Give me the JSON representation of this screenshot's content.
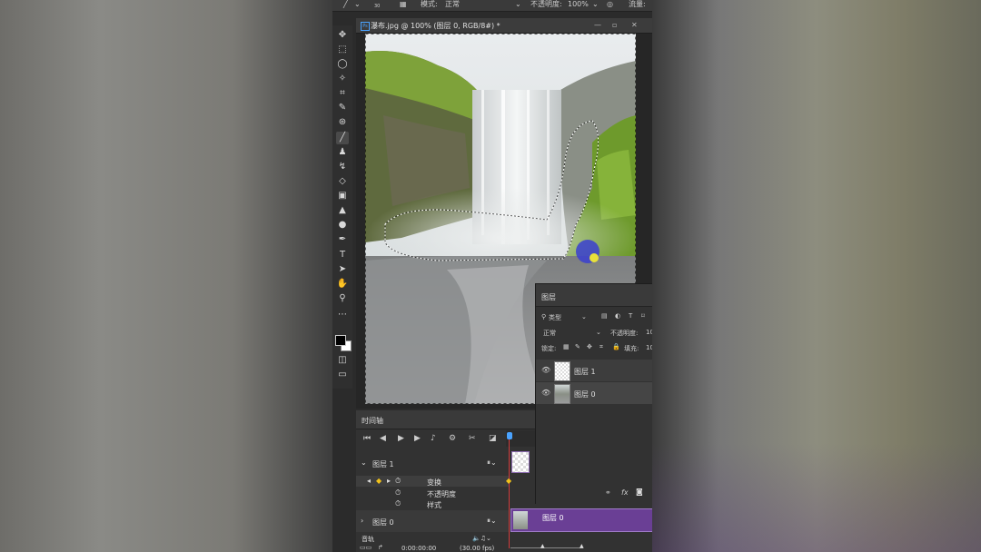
{
  "options_bar": {
    "brush_size": "30",
    "mode_label": "模式:",
    "mode_value": "正常",
    "opacity_label": "不透明度:",
    "opacity_value": "100%",
    "flow_label": "流量:"
  },
  "document": {
    "tab_title": "瀑布.jpg @ 100% (图层 0, RGB/8#) *",
    "ps_badge": "Ps"
  },
  "tools": [
    "move-tool",
    "marquee-tool",
    "lasso-tool",
    "magic-wand-tool",
    "crop-tool",
    "eyedropper-tool",
    "patch-tool",
    "brush-tool",
    "stamp-tool",
    "history-brush-tool",
    "eraser-tool",
    "gradient-tool",
    "blur-tool",
    "dodge-tool",
    "pen-tool",
    "type-tool",
    "path-select-tool",
    "hand-tool",
    "zoom-tool",
    "more-tools"
  ],
  "layers_panel": {
    "title": "图层",
    "filter_label": "类型",
    "blend_mode": "正常",
    "opacity_label": "不透明度:",
    "opacity_value": "10",
    "lock_label": "锁定:",
    "fill_label": "填充:",
    "fill_value": "10",
    "layers": [
      {
        "name": "图层 1"
      },
      {
        "name": "图层 0"
      }
    ]
  },
  "timeline": {
    "title": "时间轴",
    "track1": "图层 1",
    "prop_transform": "变换",
    "prop_opacity": "不透明度",
    "prop_style": "样式",
    "track0": "图层 0",
    "clip0_label": "图层 0",
    "audio_label": "音轨",
    "timecode": "0:00:00:00",
    "fps": "(30.00 fps)"
  },
  "colors": {
    "clip": "#6a3f95",
    "accent": "#4aa3ff",
    "playhead": "#d13b3b"
  }
}
